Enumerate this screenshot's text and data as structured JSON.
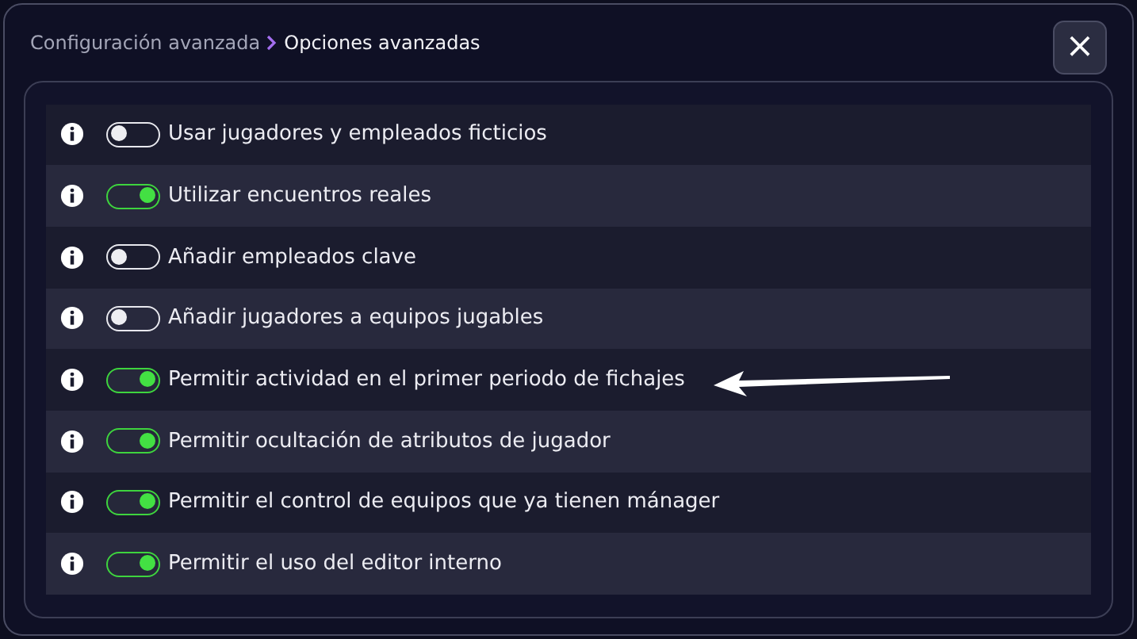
{
  "breadcrumb": [
    {
      "label": "Configuración avanzada",
      "current": false
    },
    {
      "label": "Opciones avanzadas",
      "current": true
    }
  ],
  "close_button": "×",
  "options": [
    {
      "label": "Usar jugadores y empleados ficticios",
      "on": false
    },
    {
      "label": "Utilizar encuentros reales",
      "on": true
    },
    {
      "label": "Añadir empleados clave",
      "on": false
    },
    {
      "label": "Añadir jugadores a equipos jugables",
      "on": false
    },
    {
      "label": "Permitir actividad en el primer periodo de fichajes",
      "on": true
    },
    {
      "label": "Permitir ocultación de atributos de jugador",
      "on": true
    },
    {
      "label": "Permitir el control de equipos que ya tienen mánager",
      "on": true
    },
    {
      "label": "Permitir el uso del editor interno",
      "on": true
    }
  ]
}
